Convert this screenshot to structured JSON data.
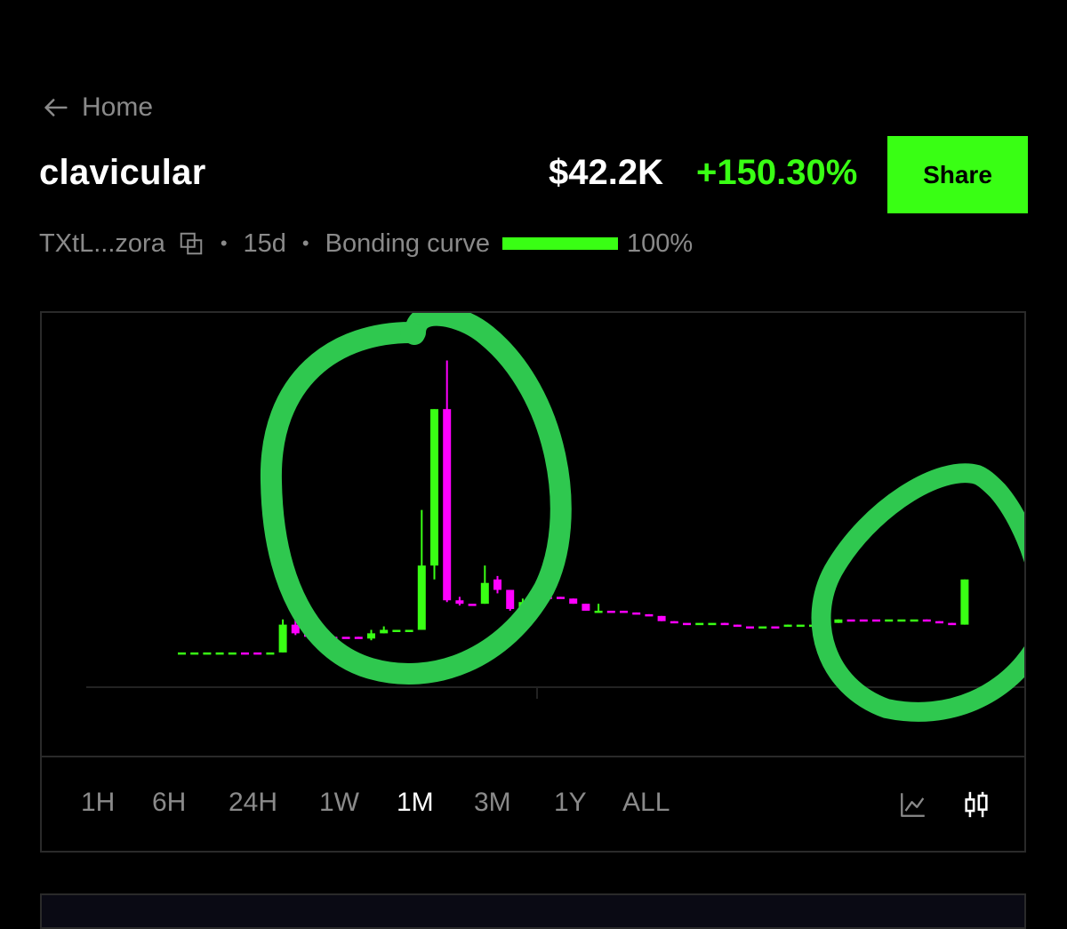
{
  "colors": {
    "accent": "#39ff14",
    "down": "#ff00ff",
    "annotation": "#2fc84f",
    "muted": "#8a8a8a"
  },
  "header": {
    "back_label": "Home",
    "title": "clavicular",
    "price": "$42.2K",
    "change": "+150.30%",
    "share_label": "Share"
  },
  "meta": {
    "address": "TXtL...zora",
    "age": "15d",
    "curve_label": "Bonding curve",
    "curve_percent": "100%",
    "curve_progress": 1.0,
    "separator": "•"
  },
  "range_tabs": [
    {
      "label": "1H",
      "active": false
    },
    {
      "label": "6H",
      "active": false
    },
    {
      "label": "24H",
      "active": false
    },
    {
      "label": "1W",
      "active": false
    },
    {
      "label": "1M",
      "active": true
    },
    {
      "label": "3M",
      "active": false
    },
    {
      "label": "1Y",
      "active": false
    },
    {
      "label": "ALL",
      "active": false
    }
  ],
  "chart_icons": [
    "line-chart-icon",
    "candlestick-chart-icon"
  ],
  "chart_data": {
    "type": "candlestick",
    "y_min": 0,
    "y_max": 100,
    "candles": [
      {
        "o": 10,
        "c": 10,
        "h": 10,
        "l": 10,
        "up": true
      },
      {
        "o": 10,
        "c": 10,
        "h": 10,
        "l": 10,
        "up": true
      },
      {
        "o": 10,
        "c": 10,
        "h": 10,
        "l": 10,
        "up": true
      },
      {
        "o": 10,
        "c": 10,
        "h": 10,
        "l": 10,
        "up": true
      },
      {
        "o": 10,
        "c": 10,
        "h": 10,
        "l": 10,
        "up": true
      },
      {
        "o": 10,
        "c": 10,
        "h": 10,
        "l": 10,
        "up": false
      },
      {
        "o": 10,
        "c": 10,
        "h": 10,
        "l": 10,
        "up": false
      },
      {
        "o": 10,
        "c": 10,
        "h": 10,
        "l": 10,
        "up": true
      },
      {
        "o": 10,
        "c": 18,
        "h": 19.5,
        "l": 10,
        "up": true
      },
      {
        "o": 18,
        "c": 15.5,
        "h": 21,
        "l": 15,
        "up": false
      },
      {
        "o": 15.5,
        "c": 14.5,
        "h": 15.5,
        "l": 14,
        "up": false
      },
      {
        "o": 14.5,
        "c": 14.5,
        "h": 14.5,
        "l": 14.5,
        "up": false
      },
      {
        "o": 14.5,
        "c": 14.5,
        "h": 14.5,
        "l": 14.5,
        "up": false
      },
      {
        "o": 14.5,
        "c": 14.5,
        "h": 14.5,
        "l": 14.5,
        "up": false
      },
      {
        "o": 14.5,
        "c": 14,
        "h": 14.5,
        "l": 14,
        "up": false
      },
      {
        "o": 14,
        "c": 15.5,
        "h": 16.5,
        "l": 13.5,
        "up": true
      },
      {
        "o": 15.5,
        "c": 16.5,
        "h": 17.5,
        "l": 15.5,
        "up": true
      },
      {
        "o": 16.5,
        "c": 16.5,
        "h": 16.5,
        "l": 16.5,
        "up": true
      },
      {
        "o": 16.5,
        "c": 16.5,
        "h": 16.5,
        "l": 16.5,
        "up": true
      },
      {
        "o": 16.5,
        "c": 35,
        "h": 51,
        "l": 16.5,
        "up": true
      },
      {
        "o": 35,
        "c": 80,
        "h": 80,
        "l": 31,
        "up": true
      },
      {
        "o": 80,
        "c": 25,
        "h": 94,
        "l": 24.5,
        "up": false
      },
      {
        "o": 25,
        "c": 24,
        "h": 26,
        "l": 23.5,
        "up": false
      },
      {
        "o": 24,
        "c": 24,
        "h": 24,
        "l": 24,
        "up": false
      },
      {
        "o": 24,
        "c": 30,
        "h": 35,
        "l": 24,
        "up": true
      },
      {
        "o": 31,
        "c": 28,
        "h": 32,
        "l": 27,
        "up": false
      },
      {
        "o": 28,
        "c": 22.5,
        "h": 28,
        "l": 22,
        "up": false
      },
      {
        "o": 22.5,
        "c": 24.5,
        "h": 25.5,
        "l": 22,
        "up": true
      },
      {
        "o": 25,
        "c": 26,
        "h": 27,
        "l": 25,
        "up": true
      },
      {
        "o": 26,
        "c": 26,
        "h": 26.5,
        "l": 25.5,
        "up": false
      },
      {
        "o": 26,
        "c": 25.5,
        "h": 26,
        "l": 25.5,
        "up": false
      },
      {
        "o": 25.5,
        "c": 24,
        "h": 25.5,
        "l": 24,
        "up": false
      },
      {
        "o": 24,
        "c": 22,
        "h": 24,
        "l": 22,
        "up": false
      },
      {
        "o": 22,
        "c": 22,
        "h": 24,
        "l": 22,
        "up": true
      },
      {
        "o": 22,
        "c": 22,
        "h": 22,
        "l": 22,
        "up": false
      },
      {
        "o": 22,
        "c": 21.5,
        "h": 22,
        "l": 21.5,
        "up": false
      },
      {
        "o": 21.5,
        "c": 21,
        "h": 21.5,
        "l": 21,
        "up": false
      },
      {
        "o": 21,
        "c": 20.5,
        "h": 21,
        "l": 20.5,
        "up": false
      },
      {
        "o": 20.5,
        "c": 19,
        "h": 20.5,
        "l": 19,
        "up": false
      },
      {
        "o": 19,
        "c": 18.5,
        "h": 19,
        "l": 18.5,
        "up": false
      },
      {
        "o": 18.5,
        "c": 18.5,
        "h": 18.5,
        "l": 18.5,
        "up": false
      },
      {
        "o": 18.5,
        "c": 18.5,
        "h": 18.5,
        "l": 18.5,
        "up": true
      },
      {
        "o": 18.5,
        "c": 18.5,
        "h": 18.5,
        "l": 18.5,
        "up": true
      },
      {
        "o": 18.5,
        "c": 18,
        "h": 18.5,
        "l": 18,
        "up": false
      },
      {
        "o": 18,
        "c": 17.5,
        "h": 18,
        "l": 17.5,
        "up": false
      },
      {
        "o": 17.5,
        "c": 17.5,
        "h": 17.5,
        "l": 17.5,
        "up": false
      },
      {
        "o": 17.5,
        "c": 17.5,
        "h": 17.5,
        "l": 17.5,
        "up": true
      },
      {
        "o": 17.5,
        "c": 17.5,
        "h": 17.5,
        "l": 17.5,
        "up": false
      },
      {
        "o": 17.5,
        "c": 18,
        "h": 18,
        "l": 17.5,
        "up": true
      },
      {
        "o": 18,
        "c": 18,
        "h": 18,
        "l": 18,
        "up": true
      },
      {
        "o": 18,
        "c": 18,
        "h": 18,
        "l": 18,
        "up": true
      },
      {
        "o": 18,
        "c": 18.5,
        "h": 18.5,
        "l": 18,
        "up": true
      },
      {
        "o": 18.5,
        "c": 19.5,
        "h": 19.5,
        "l": 18.5,
        "up": true
      },
      {
        "o": 19.5,
        "c": 19.5,
        "h": 19.5,
        "l": 19.5,
        "up": false
      },
      {
        "o": 19.5,
        "c": 19.5,
        "h": 19.5,
        "l": 19.5,
        "up": false
      },
      {
        "o": 19.5,
        "c": 19.5,
        "h": 19.5,
        "l": 19.5,
        "up": false
      },
      {
        "o": 19.5,
        "c": 19.5,
        "h": 19.5,
        "l": 19.5,
        "up": true
      },
      {
        "o": 19.5,
        "c": 19.5,
        "h": 19.5,
        "l": 19.5,
        "up": true
      },
      {
        "o": 19.5,
        "c": 19.5,
        "h": 19.5,
        "l": 19.5,
        "up": true
      },
      {
        "o": 19.5,
        "c": 19,
        "h": 19.5,
        "l": 19,
        "up": false
      },
      {
        "o": 19,
        "c": 18.5,
        "h": 19,
        "l": 18.5,
        "up": false
      },
      {
        "o": 18.5,
        "c": 18,
        "h": 18.5,
        "l": 18,
        "up": false
      },
      {
        "o": 18,
        "c": 31,
        "h": 31,
        "l": 18,
        "up": true
      }
    ]
  }
}
